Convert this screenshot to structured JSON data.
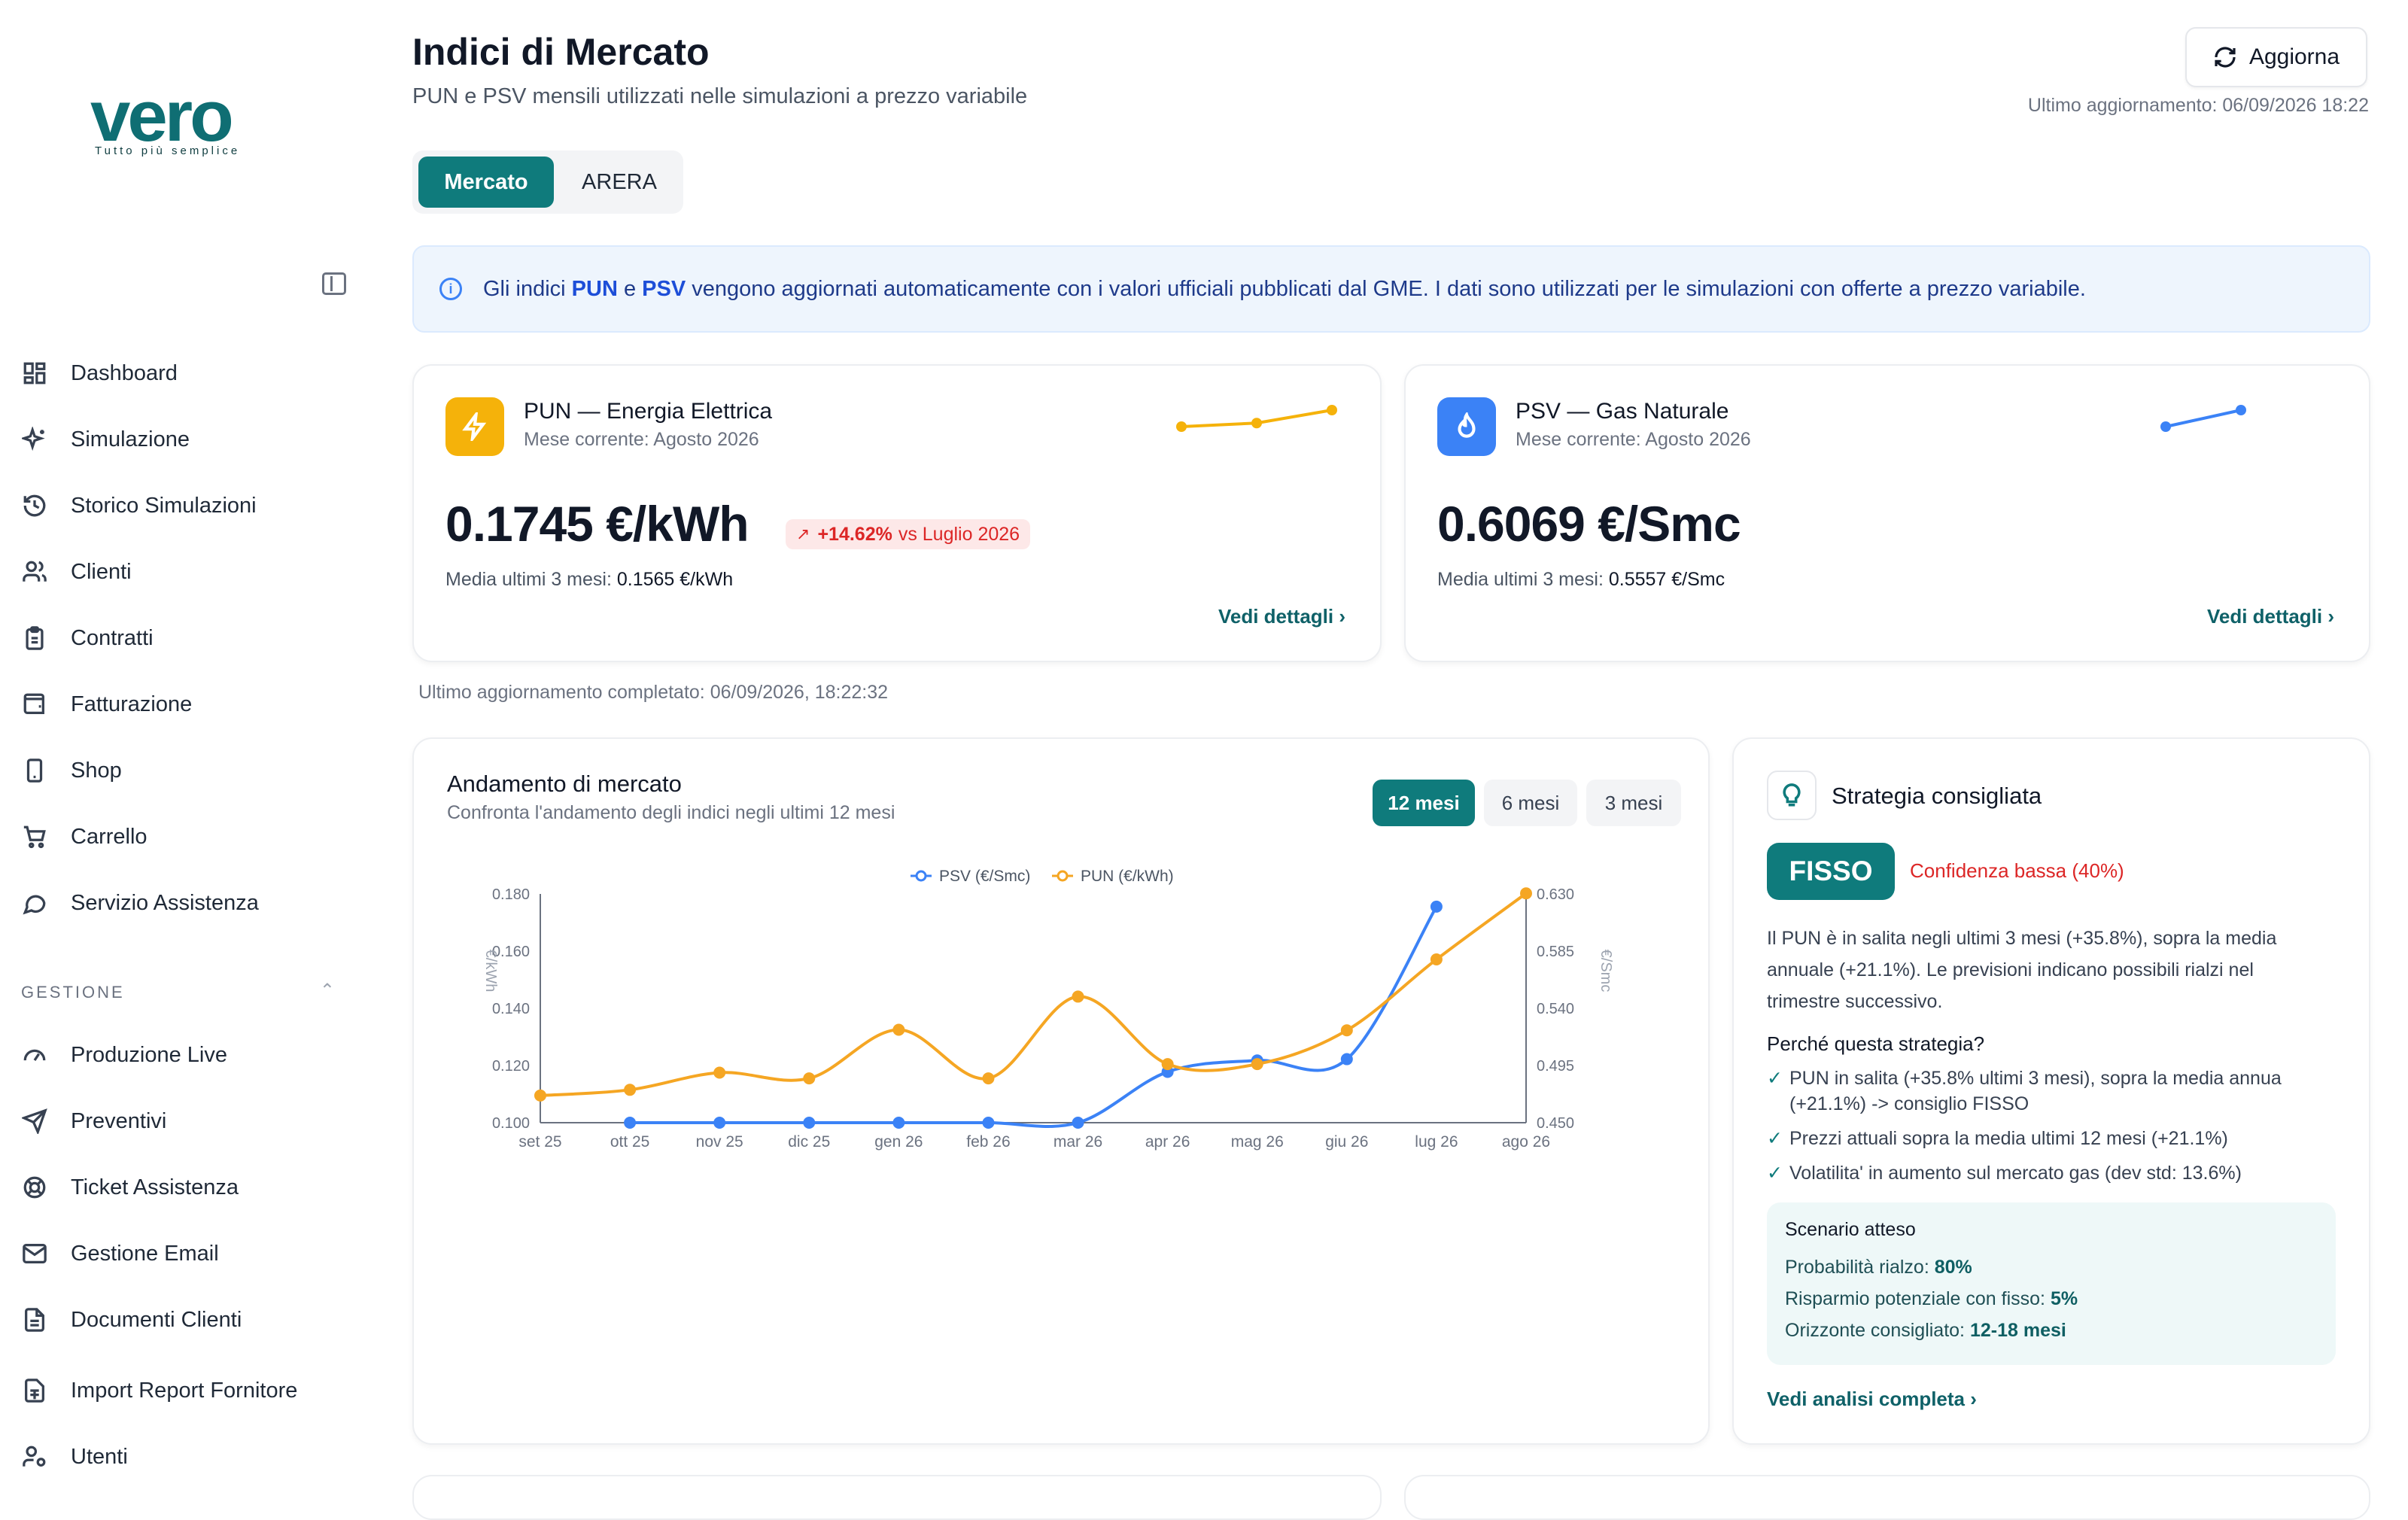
{
  "brand": {
    "logo_text": "vero",
    "tagline": "Tutto più semplice"
  },
  "sidebar": {
    "items": [
      {
        "label": "Dashboard",
        "icon": "dashboard-icon"
      },
      {
        "label": "Simulazione",
        "icon": "sparkles-icon"
      },
      {
        "label": "Storico Simulazioni",
        "icon": "history-icon"
      },
      {
        "label": "Clienti",
        "icon": "users-icon"
      },
      {
        "label": "Contratti",
        "icon": "clipboard-icon"
      },
      {
        "label": "Fatturazione",
        "icon": "wallet-icon"
      },
      {
        "label": "Shop",
        "icon": "phone-icon"
      },
      {
        "label": "Carrello",
        "icon": "cart-icon"
      },
      {
        "label": "Servizio Assistenza",
        "icon": "chat-icon"
      }
    ],
    "section_label": "GESTIONE",
    "section_items": [
      {
        "label": "Produzione Live",
        "icon": "gauge-icon"
      },
      {
        "label": "Preventivi",
        "icon": "send-icon"
      },
      {
        "label": "Ticket Assistenza",
        "icon": "lifebuoy-icon"
      },
      {
        "label": "Gestione Email",
        "icon": "mail-icon"
      },
      {
        "label": "Documenti Clienti",
        "icon": "document-icon"
      },
      {
        "label": "Import Report Fornitore",
        "icon": "spreadsheet-icon"
      },
      {
        "label": "Utenti",
        "icon": "user-key-icon"
      }
    ]
  },
  "header": {
    "title": "Indici di Mercato",
    "subtitle": "PUN e PSV mensili utilizzati nelle simulazioni a prezzo variabile",
    "refresh_label": "Aggiorna",
    "last_update": "Ultimo aggiornamento: 06/09/2026 18:22"
  },
  "tabs": [
    {
      "label": "Mercato",
      "active": true
    },
    {
      "label": "ARERA",
      "active": false
    }
  ],
  "info": {
    "text_1": "Gli indici ",
    "pun": "PUN",
    "text_2": " e ",
    "psv": "PSV",
    "text_3": " vengono aggiornati automaticamente con i valori ufficiali pubblicati dal GME. I dati sono utilizzati per le simulazioni con offerte a prezzo variabile."
  },
  "pun": {
    "title": "PUN — Energia Elettrica",
    "current_month": "Mese corrente: Agosto 2026",
    "value": "0.1745 €/kWh",
    "change": "+14.62%",
    "change_ref": "vs Luglio 2026",
    "avg_label": "Media ultimi 3 mesi: ",
    "avg_value": "0.1565 €/kWh",
    "details": "Vedi dettagli ›",
    "color": "#f5b20a",
    "sparkline": [
      0.1523,
      0.1571,
      0.1745
    ]
  },
  "psv": {
    "title": "PSV — Gas Naturale",
    "current_month": "Mese corrente: Agosto 2026",
    "value": "0.6069 €/Smc",
    "avg_label": "Media ultimi 3 mesi: ",
    "avg_value": "0.5557 €/Smc",
    "details": "Vedi dettagli ›",
    "color": "#3b82f6",
    "sparkline": [
      0.5942,
      0.6069
    ]
  },
  "completed_update": "Ultimo aggiornamento completato: 06/09/2026, 18:22:32",
  "chart_panel": {
    "title": "Andamento di mercato",
    "subtitle": "Confronta l'andamento degli indici negli ultimi 12 mesi",
    "ranges": [
      {
        "label": "12 mesi",
        "active": true
      },
      {
        "label": "6 mesi",
        "active": false
      },
      {
        "label": "3 mesi",
        "active": false
      }
    ]
  },
  "chart_data": {
    "type": "line",
    "x": [
      "set 25",
      "ott 25",
      "nov 25",
      "dic 25",
      "gen 26",
      "feb 26",
      "mar 26",
      "apr 26",
      "mag 26",
      "giu 26",
      "lug 26",
      "ago 26"
    ],
    "series": [
      {
        "name": "PSV (€/Smc)",
        "axis": "right",
        "color": "#3b82f6",
        "values": [
          null,
          0.45,
          0.45,
          0.45,
          0.45,
          0.45,
          0.45,
          0.49,
          0.499,
          0.5,
          0.62,
          null
        ]
      },
      {
        "name": "PUN (€/kWh)",
        "axis": "left",
        "color": "#f5a623",
        "values": [
          0.1095,
          0.1115,
          0.1175,
          0.1155,
          0.1325,
          0.1155,
          0.1441,
          0.1205,
          0.1205,
          0.1323,
          0.1571,
          0.1802
        ]
      }
    ],
    "y_left": {
      "label": "€/kWh",
      "ticks": [
        "0.100",
        "0.120",
        "0.140",
        "0.160",
        "0.180"
      ],
      "range": [
        0.1,
        0.18
      ]
    },
    "y_right": {
      "label": "€/Smc",
      "ticks": [
        "0.450",
        "0.495",
        "0.540",
        "0.585",
        "0.630"
      ],
      "range": [
        0.45,
        0.63
      ]
    },
    "legend_position": "top-center",
    "grid": false
  },
  "strategy": {
    "title": "Strategia consigliata",
    "badge": "FISSO",
    "confidence": "Confidenza bassa (40%)",
    "description": "Il PUN è in salita negli ultimi 3 mesi (+35.8%), sopra la media annuale (+21.1%). Le previsioni indicano possibili rialzi nel trimestre successivo.",
    "why_title": "Perché questa strategia?",
    "reasons": [
      "PUN in salita (+35.8% ultimi 3 mesi), sopra la media annua (+21.1%) -> consiglio FISSO",
      "Prezzi attuali sopra la media ultimi 12 mesi (+21.1%)",
      "Volatilita' in aumento sul mercato gas (dev std: 13.6%)"
    ],
    "scenario": {
      "title": "Scenario atteso",
      "rows": [
        {
          "label": "Probabilità rialzo: ",
          "value": "80%"
        },
        {
          "label": "Risparmio potenziale con fisso: ",
          "value": "5%"
        },
        {
          "label": "Orizzonte consigliato: ",
          "value": "12-18 mesi"
        }
      ]
    },
    "full_analysis": "Vedi analisi completa ›"
  }
}
